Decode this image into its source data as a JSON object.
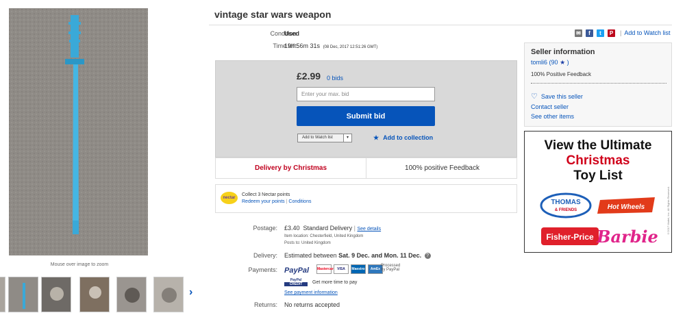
{
  "title": "vintage star wars weapon",
  "gallery": {
    "zoom_hint": "Mouse over image to zoom",
    "next_icon": "chevron-right-icon"
  },
  "listing": {
    "condition_label": "Condition:",
    "condition_value": "Used",
    "time_left_label": "Time left:",
    "time_left_value": "19h 56m 31s",
    "time_left_end": "(08 Dec, 2017   12:51:26 GMT)"
  },
  "bid": {
    "price": "£2.99",
    "bids": "0 bids",
    "input_placeholder": "Enter your max. bid",
    "submit_label": "Submit bid",
    "watch_select": "Add to Watch list",
    "add_collection": "Add to collection"
  },
  "strip": {
    "delivery": "Delivery by Christmas",
    "feedback": "100% positive Feedback"
  },
  "nectar": {
    "logo": "nectar",
    "line1": "Collect 3 Nectar points",
    "redeem": "Redeem your points",
    "sep": "|",
    "conditions": "Conditions"
  },
  "postage": {
    "label": "Postage:",
    "price": "£3.40",
    "service": "Standard Delivery",
    "sep": "|",
    "see_details": "See details",
    "item_location": "Item location:  Chesterfield, United Kingdom",
    "posts_to": "Posts to:  United Kingdom"
  },
  "delivery": {
    "label": "Delivery:",
    "prefix": "Estimated between",
    "range": "Sat. 9 Dec. and Mon. 11 Dec.",
    "info_icon": "info-icon"
  },
  "payments": {
    "label": "Payments:",
    "paypal": "PayPal",
    "cards": [
      "Mastercard",
      "VISA",
      "Maestro",
      "AmEx"
    ],
    "processed": "Processed",
    "by_paypal": "by PayPal",
    "credit_logo_1": "PayPal",
    "credit_logo_2": "CREDIT",
    "credit_text": "Get more time to pay",
    "see_payment": "See payment information"
  },
  "returns": {
    "label": "Returns:",
    "value": "No returns accepted"
  },
  "share": {
    "icons": [
      "email-icon",
      "facebook-icon",
      "twitter-icon",
      "pinterest-icon"
    ],
    "sep": "|",
    "watch_link": "Add to Watch list"
  },
  "seller": {
    "heading": "Seller information",
    "name": "tomli6",
    "score": "(90",
    "score_close": ")",
    "positive": "100% Positive Feedback",
    "save": "Save this seller",
    "contact": "Contact seller",
    "other": "See other items"
  },
  "ad": {
    "line1": "View the Ultimate",
    "line2": "Christmas",
    "line3": "Toy List",
    "brands": [
      "THOMAS & FRIENDS",
      "Hot Wheels",
      "Fisher-Price",
      "Barbie"
    ],
    "copyright": "©2017 Mattel, Inc. All Rights Reserved."
  },
  "colors": {
    "accent": "#0654ba",
    "delivery_red": "#c0001e",
    "ad_red": "#d0021b"
  }
}
